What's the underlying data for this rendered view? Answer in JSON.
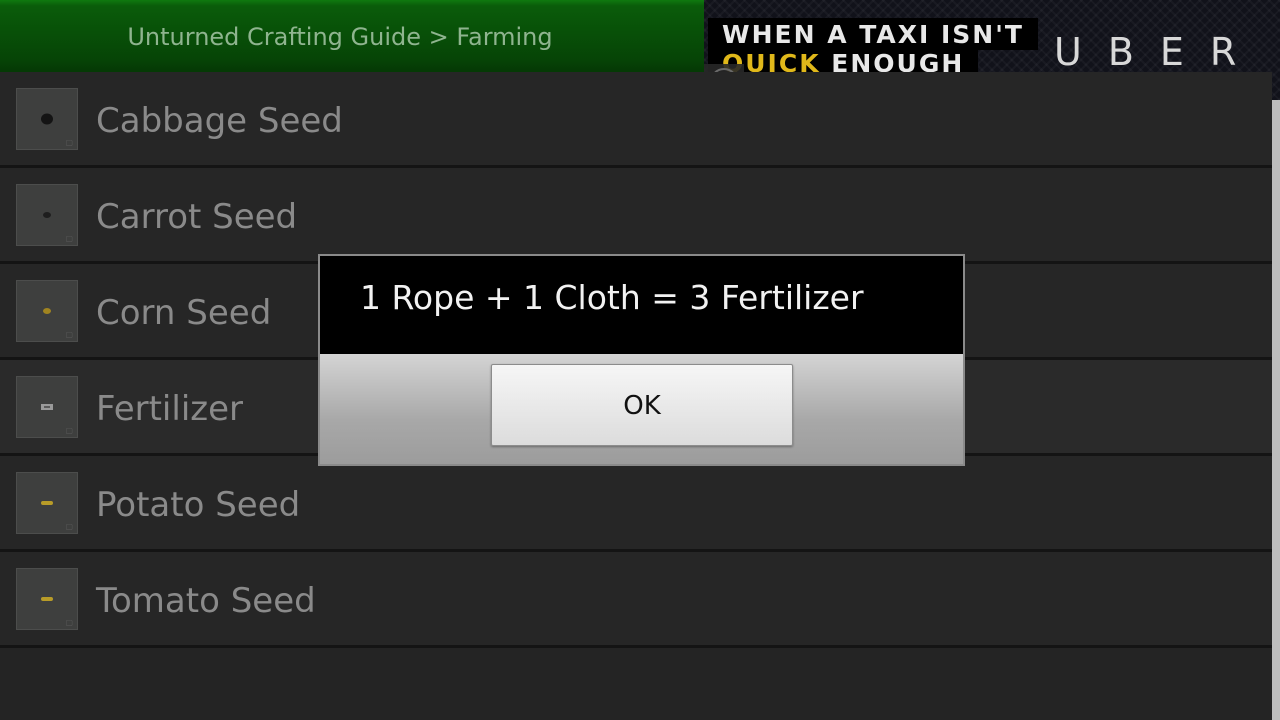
{
  "header": {
    "title": "Unturned Crafting Guide > Farming"
  },
  "ad": {
    "line1": "WHEN A TAXI ISN'T",
    "line2_accent": "QUICK",
    "line2_rest": " ENOUGH",
    "brand": "UBER",
    "info_icon": "i"
  },
  "list": {
    "items": [
      {
        "label": "Cabbage Seed",
        "icon": "cabbage-seed-icon",
        "seed_color": "#141414"
      },
      {
        "label": "Carrot Seed",
        "icon": "carrot-seed-icon",
        "seed_color": "#1e1e1e"
      },
      {
        "label": "Corn Seed",
        "icon": "corn-seed-icon",
        "seed_color": "#a08420"
      },
      {
        "label": "Fertilizer",
        "icon": "fertilizer-icon",
        "seed_color": "#9a9a9a"
      },
      {
        "label": "Potato Seed",
        "icon": "potato-seed-icon",
        "seed_color": "#b89c28"
      },
      {
        "label": "Tomato Seed",
        "icon": "tomato-seed-icon",
        "seed_color": "#b89c28"
      }
    ]
  },
  "dialog": {
    "message": "1 Rope + 1 Cloth = 3 Fertilizer",
    "ok_label": "OK"
  },
  "colors": {
    "header_green": "#064406",
    "ad_accent": "#e0b81a"
  }
}
